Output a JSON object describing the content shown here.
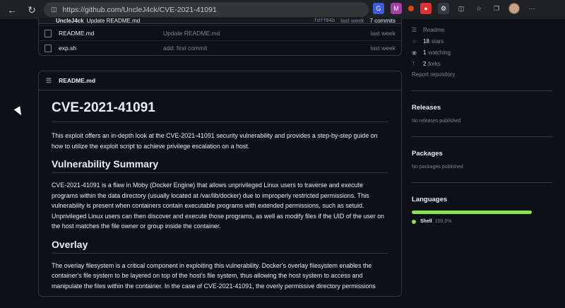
{
  "browser": {
    "url": "https://github.com/UncleJ4ck/CVE-2021-41091"
  },
  "commit": {
    "author": "UncleJ4ck",
    "message": "Update README.md",
    "hash": "fdff84b",
    "when": "last week",
    "count": "7 commits"
  },
  "files": [
    {
      "name": "README.md",
      "message": "Update README.md",
      "time": "last week"
    },
    {
      "name": "exp.sh",
      "message": "add: first commit",
      "time": "last week"
    }
  ],
  "readme": {
    "header": "README.md",
    "title": "CVE-2021-41091",
    "intro": "This exploit offers an in-depth look at the CVE-2021-41091 security vulnerability and provides a step-by-step guide on how to utilize the exploit script to achieve privilege escalation on a host.",
    "h2_summary": "Vulnerability Summary",
    "summary": "CVE-2021-41091 is a flaw in Moby (Docker Engine) that allows unprivileged Linux users to traverse and execute programs within the data directory (usually located at /var/lib/docker) due to improperly restricted permissions. This vulnerability is present when containers contain executable programs with extended permissions, such as setuid. Unprivileged Linux users can then discover and execute those programs, as well as modify files if the UID of the user on the host matches the file owner or group inside the container.",
    "h2_overlay": "Overlay",
    "overlay": "The overlay filesystem is a critical component in exploiting this vulnerability. Docker's overlay filesystem enables the container's file system to be layered on top of the host's file system, thus allowing the host system to access and manipulate the files within the container. In the case of CVE-2021-41091, the overly permissive directory permissions"
  },
  "sidebar": {
    "readme": "Readme",
    "stars": "18",
    "stars_label": "stars",
    "watching": "1",
    "watching_label": "watching",
    "forks": "2",
    "forks_label": "forks",
    "report": "Report repository",
    "releases_title": "Releases",
    "releases_text": "No releases published",
    "packages_title": "Packages",
    "packages_text": "No packages published",
    "languages_title": "Languages",
    "lang_name": "Shell",
    "lang_pct": "100.0%",
    "lang_color": "#89e051"
  }
}
